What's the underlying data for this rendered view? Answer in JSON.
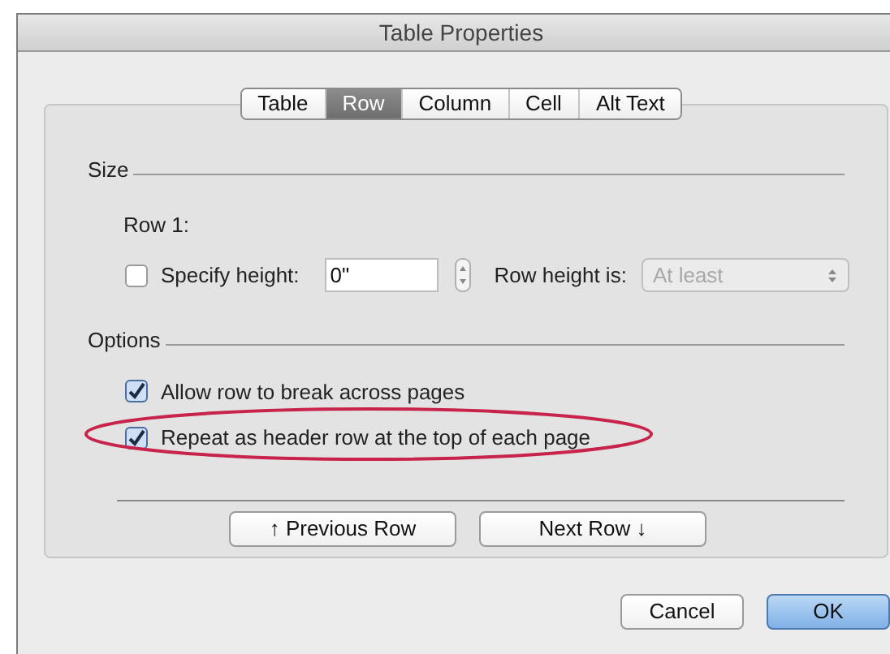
{
  "window": {
    "title": "Table Properties"
  },
  "tabs": [
    {
      "label": "Table",
      "selected": false
    },
    {
      "label": "Row",
      "selected": true
    },
    {
      "label": "Column",
      "selected": false
    },
    {
      "label": "Cell",
      "selected": false
    },
    {
      "label": "Alt Text",
      "selected": false
    }
  ],
  "size_section": {
    "label": "Size",
    "row_label": "Row 1:",
    "specify_height": {
      "label": "Specify height:",
      "checked": false
    },
    "height_field": {
      "value": "0\""
    },
    "row_height_is": {
      "label": "Row height is:",
      "value": "At least",
      "disabled": true
    }
  },
  "options_section": {
    "label": "Options",
    "options": [
      {
        "label": "Allow row to break across pages",
        "checked": true,
        "highlighted": false
      },
      {
        "label": "Repeat as header row at the top of each page",
        "checked": true,
        "highlighted": true
      }
    ]
  },
  "nav_buttons": [
    "↑ Previous Row",
    "Next Row ↓"
  ],
  "buttons": [
    {
      "label": "Cancel",
      "default": false
    },
    {
      "label": "OK",
      "default": true
    }
  ]
}
